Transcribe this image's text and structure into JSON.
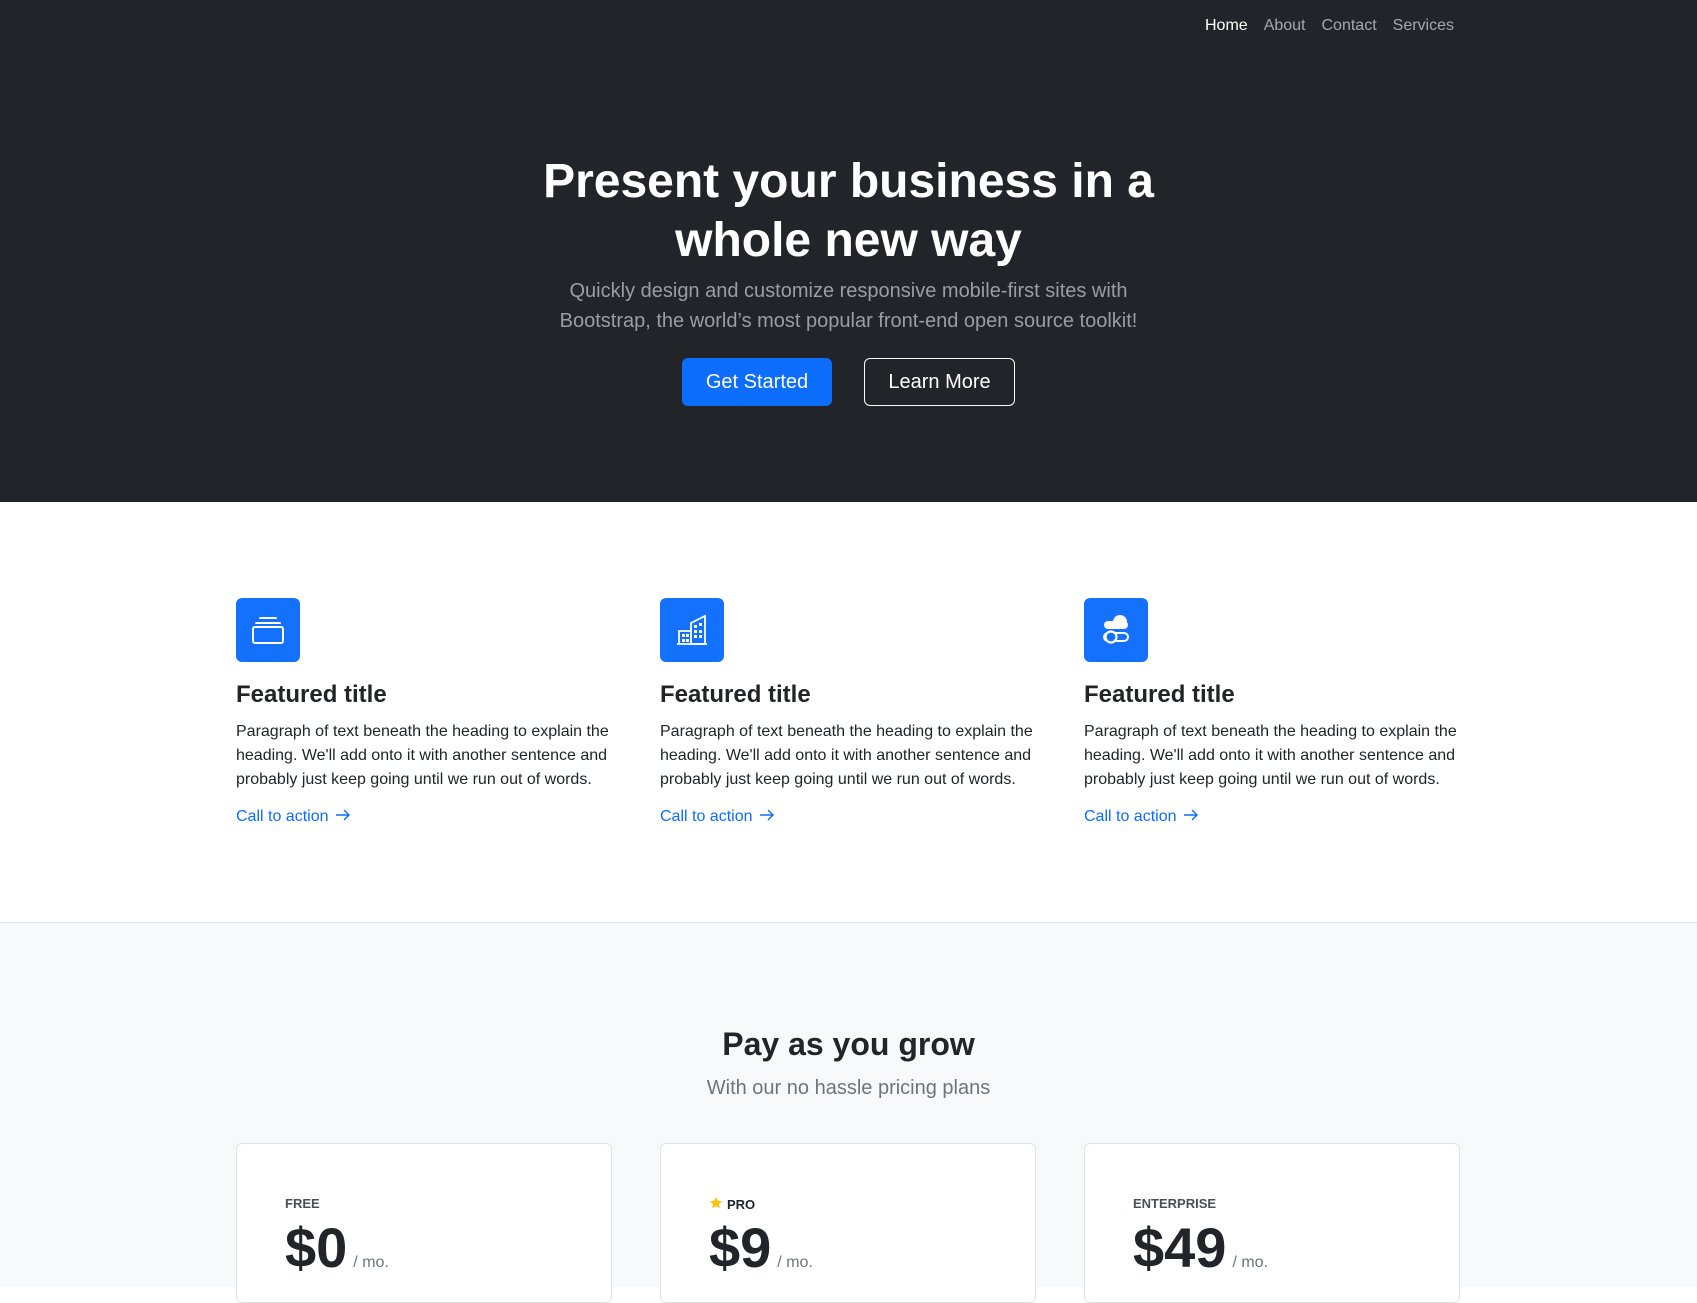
{
  "nav": {
    "items": [
      {
        "label": "Home",
        "active": true
      },
      {
        "label": "About",
        "active": false
      },
      {
        "label": "Contact",
        "active": false
      },
      {
        "label": "Services",
        "active": false
      }
    ]
  },
  "hero": {
    "title_line1": "Present your business in a",
    "title_line2": "whole new way",
    "lead_line1": "Quickly design and customize responsive mobile-first sites with",
    "lead_line2": "Bootstrap, the world’s most popular front-end open source toolkit!",
    "primary_button": "Get Started",
    "secondary_button": "Learn More"
  },
  "features": [
    {
      "icon": "collection-icon",
      "title": "Featured title",
      "text": "Paragraph of text beneath the heading to explain the heading. We'll add onto it with another sentence and probably just keep going until we run out of words.",
      "link": "Call to action"
    },
    {
      "icon": "building-icon",
      "title": "Featured title",
      "text": "Paragraph of text beneath the heading to explain the heading. We'll add onto it with another sentence and probably just keep going until we run out of words.",
      "link": "Call to action"
    },
    {
      "icon": "toggles-icon",
      "title": "Featured title",
      "text": "Paragraph of text beneath the heading to explain the heading. We'll add onto it with another sentence and probably just keep going until we run out of words.",
      "link": "Call to action"
    }
  ],
  "pricing": {
    "title": "Pay as you grow",
    "subtitle": "With our no hassle pricing plans",
    "plans": [
      {
        "name": "FREE",
        "price": "$0",
        "period": "/ mo.",
        "starred": false
      },
      {
        "name": "PRO",
        "price": "$9",
        "period": "/ mo.",
        "starred": true
      },
      {
        "name": "ENTERPRISE",
        "price": "$49",
        "period": "/ mo.",
        "starred": false
      }
    ]
  },
  "colors": {
    "hero_bg": "#212529",
    "primary": "#0d6efd",
    "star": "#ffc107",
    "pricing_bg": "#f8f9fa"
  }
}
